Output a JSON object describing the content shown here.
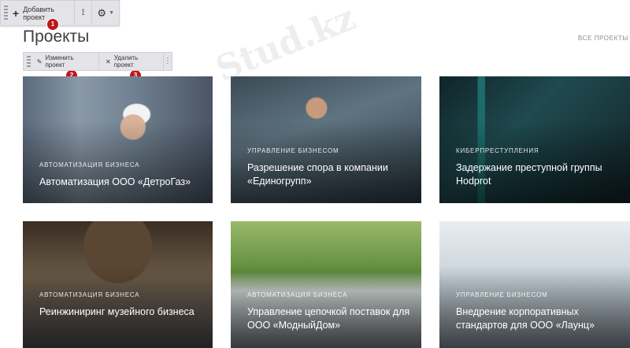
{
  "admin_toolbar": {
    "add_label": "Добавить проект",
    "badge": "1"
  },
  "page": {
    "title": "Проекты",
    "all_link": "ВСЕ ПРОЕКТЫ"
  },
  "item_toolbar": {
    "edit_label": "Изменить проект",
    "delete_label": "Удалить проект",
    "edit_badge": "2",
    "delete_badge": "3"
  },
  "cards": [
    {
      "category": "АВТОМАТИЗАЦИЯ БИЗНЕСА",
      "title": "Автоматизация ООО «ДетроГаз»"
    },
    {
      "category": "УПРАВЛЕНИЕ БИЗНЕСОМ",
      "title": "Разрешение спора в компании «Единогрупп»"
    },
    {
      "category": "КИБЕРПРЕСТУПЛЕНИЯ",
      "title": "Задержание преступной группы Hodprot"
    },
    {
      "category": "АВТОМАТИЗАЦИЯ БИЗНЕСА",
      "title": "Реинжиниринг музейного бизнеса"
    },
    {
      "category": "АВТОМАТИЗАЦИЯ БИЗНЕСА",
      "title": "Управление цепочкой поставок для ООО «МодныйДом»"
    },
    {
      "category": "УПРАВЛЕНИЕ БИЗНЕСОМ",
      "title": "Внедрение корпоративных стандартов для ООО «Лаунц»"
    }
  ],
  "watermark": "Stud.kz"
}
